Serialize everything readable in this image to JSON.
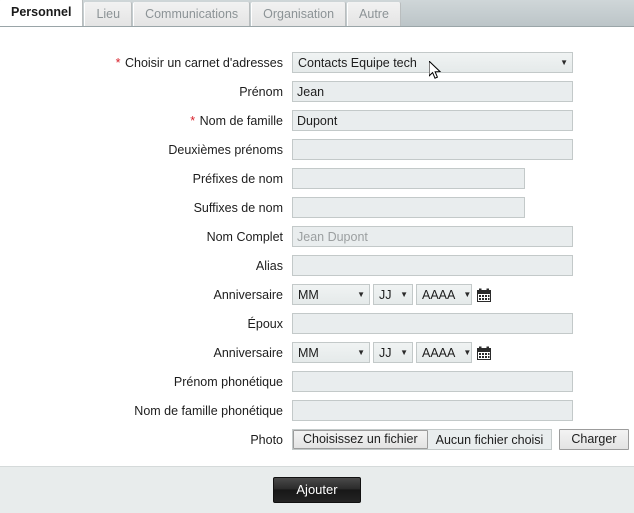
{
  "tabs": [
    {
      "label": "Personnel",
      "active": true
    },
    {
      "label": "Lieu",
      "active": false
    },
    {
      "label": "Communications",
      "active": false
    },
    {
      "label": "Organisation",
      "active": false
    },
    {
      "label": "Autre",
      "active": false
    }
  ],
  "form": {
    "address_book": {
      "label": "Choisir un carnet d'adresses",
      "required": true,
      "value": "Contacts Equipe tech"
    },
    "first_name": {
      "label": "Prénom",
      "required": false,
      "value": "Jean",
      "placeholder": ""
    },
    "last_name": {
      "label": "Nom de famille",
      "required": true,
      "value": "Dupont",
      "placeholder": ""
    },
    "middle_names": {
      "label": "Deuxièmes prénoms",
      "required": false,
      "value": "",
      "placeholder": ""
    },
    "name_prefixes": {
      "label": "Préfixes de nom",
      "required": false,
      "value": "",
      "placeholder": ""
    },
    "name_suffixes": {
      "label": "Suffixes de nom",
      "required": false,
      "value": "",
      "placeholder": ""
    },
    "full_name": {
      "label": "Nom Complet",
      "required": false,
      "value": "",
      "placeholder": "Jean Dupont",
      "disabled": true
    },
    "alias": {
      "label": "Alias",
      "required": false,
      "value": "",
      "placeholder": ""
    },
    "birthday": {
      "label": "Anniversaire",
      "month": "MM",
      "day": "JJ",
      "year": "AAAA"
    },
    "spouse": {
      "label": "Époux",
      "required": false,
      "value": "",
      "placeholder": ""
    },
    "anniversary": {
      "label": "Anniversaire",
      "month": "MM",
      "day": "JJ",
      "year": "AAAA"
    },
    "phonetic_first_name": {
      "label": "Prénom phonétique",
      "required": false,
      "value": "",
      "placeholder": ""
    },
    "phonetic_last_name": {
      "label": "Nom de famille phonétique",
      "required": false,
      "value": "",
      "placeholder": ""
    },
    "photo": {
      "label": "Photo",
      "choose_button": "Choisissez un fichier",
      "no_file_text": "Aucun fichier choisi",
      "upload_button": "Charger"
    }
  },
  "footer": {
    "submit_label": "Ajouter"
  },
  "colors": {
    "required_asterisk": "#d8202a",
    "tab_active_text": "#1a1a1a",
    "tab_inactive_text": "#8c9396",
    "input_background": "#e9edee",
    "input_border": "#c3c9c9",
    "submit_background": "#232323",
    "footer_background": "#e8ecec",
    "tabbar_background": "#bcc5c8"
  },
  "icons": {
    "caret": "▼",
    "asterisk": "*"
  }
}
